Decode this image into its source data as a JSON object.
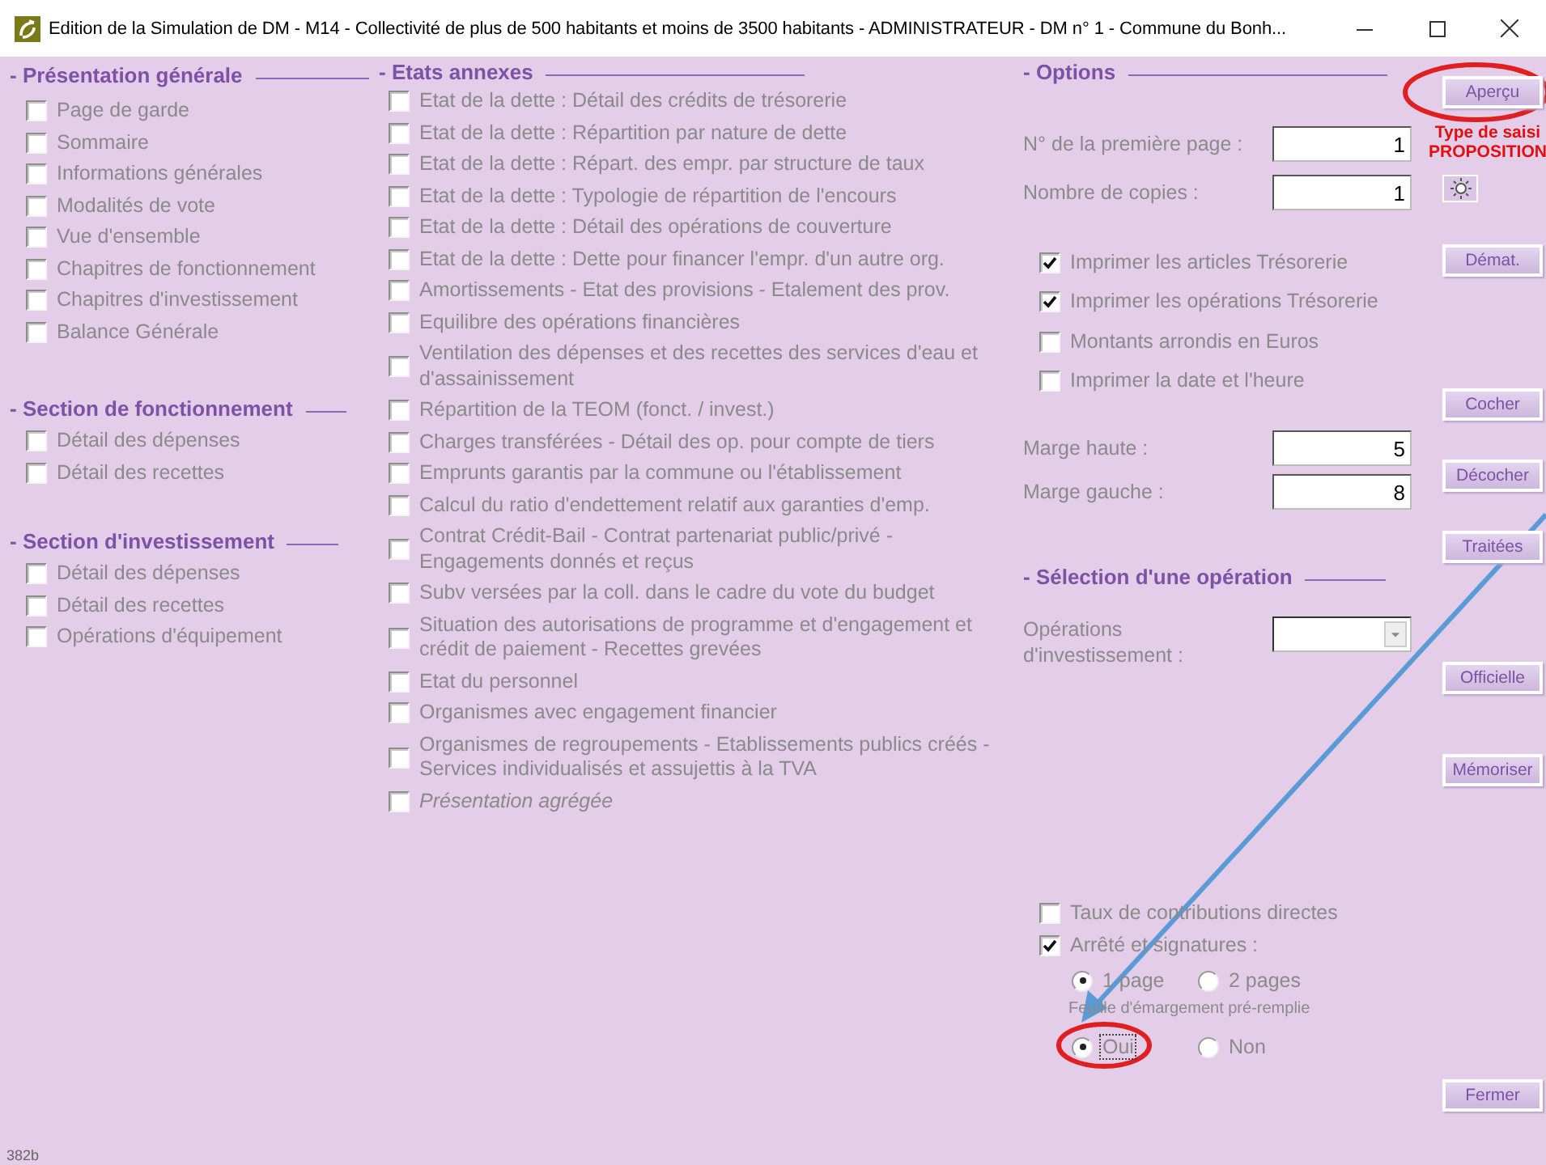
{
  "window": {
    "title": "Edition de la Simulation de DM - M14 - Collectivité de plus de 500 habitants et moins de 3500 habitants - ADMINISTRATEUR - DM n° 1 - Commune du Bonh..."
  },
  "left_sections": [
    {
      "title": "- Présentation générale",
      "items": [
        {
          "label": "Page de garde",
          "checked": false
        },
        {
          "label": "Sommaire",
          "checked": false
        },
        {
          "label": "Informations générales",
          "checked": false
        },
        {
          "label": "Modalités de vote",
          "checked": false
        },
        {
          "label": "Vue d'ensemble",
          "checked": false
        },
        {
          "label": "Chapitres de fonctionnement",
          "checked": false
        },
        {
          "label": "Chapitres d'investissement",
          "checked": false
        },
        {
          "label": "Balance Générale",
          "checked": false
        }
      ]
    },
    {
      "title": "- Section de fonctionnement",
      "items": [
        {
          "label": "Détail des dépenses",
          "checked": false
        },
        {
          "label": "Détail des recettes",
          "checked": false
        }
      ]
    },
    {
      "title": "- Section d'investissement",
      "items": [
        {
          "label": "Détail des dépenses",
          "checked": false
        },
        {
          "label": "Détail des recettes",
          "checked": false
        },
        {
          "label": "Opérations d'équipement",
          "checked": false
        }
      ]
    }
  ],
  "etats_annexes": {
    "title": "- Etats annexes",
    "items": [
      {
        "label": "Etat de la dette : Détail des crédits de trésorerie",
        "checked": false,
        "kind": "plain"
      },
      {
        "label": "Etat de la dette : Répartition par nature de dette",
        "checked": false,
        "kind": "plain"
      },
      {
        "label": "Etat de la dette : Répart. des empr. par structure de taux",
        "checked": false,
        "kind": "plain"
      },
      {
        "label": "Etat de la dette : Typologie de répartition de l'encours",
        "checked": false,
        "kind": "plain"
      },
      {
        "label": "Etat de la dette : Détail des opérations de couverture",
        "checked": false,
        "kind": "plain"
      },
      {
        "label": "Etat de la dette : Dette pour financer l'empr. d'un autre org.",
        "checked": false,
        "kind": "plain"
      },
      {
        "label": "Amortissements - Etat des provisions - Etalement des prov.",
        "checked": false,
        "kind": "plain"
      },
      {
        "label": "Equilibre des opérations financières",
        "checked": false,
        "kind": "plain"
      },
      {
        "label": "Ventilation des dépenses et des recettes des services d'eau et d'assainissement",
        "checked": false,
        "kind": "plain"
      },
      {
        "label": "Répartition de la TEOM (fonct. / invest.)",
        "checked": false,
        "kind": "plain"
      },
      {
        "label": "Charges transférées - Détail des op. pour compte de tiers",
        "checked": false,
        "kind": "plain"
      },
      {
        "label": "Emprunts garantis par la commune ou l'établissement",
        "checked": false,
        "kind": "plain"
      },
      {
        "label": "Calcul du ratio d'endettement relatif aux garanties d'emp.",
        "checked": false,
        "kind": "plain"
      },
      {
        "label": "Contrat Crédit-Bail - Contrat partenariat public/privé - Engagements donnés et reçus",
        "checked": false,
        "kind": "plain"
      },
      {
        "label": "Subv versées par la coll. dans le cadre du vote du budget",
        "checked": false,
        "kind": "plain"
      },
      {
        "label": "Situation des autorisations de programme et d'engagement et crédit de paiement - Recettes grevées",
        "checked": false,
        "kind": "plain"
      },
      {
        "label": "Etat du personnel",
        "checked": false,
        "kind": "plain"
      },
      {
        "label": "Organismes avec engagement financier",
        "checked": false,
        "kind": "plain"
      },
      {
        "label": "Organismes de regroupements - Etablissements publics créés - Services individualisés et assujettis à la TVA",
        "checked": false,
        "kind": "plain"
      },
      {
        "label": "Présentation agrégée",
        "checked": false,
        "kind": "italic"
      }
    ]
  },
  "options": {
    "title": "- Options",
    "page_fields": [
      {
        "label": "N° de la première page :",
        "value": "1"
      },
      {
        "label": "Nombre de copies :",
        "value": "1"
      }
    ],
    "print_checks": [
      {
        "label": "Imprimer les articles Trésorerie",
        "checked": true
      },
      {
        "label": "Imprimer les opérations Trésorerie",
        "checked": true
      },
      {
        "label": "Montants arrondis en Euros",
        "checked": false
      },
      {
        "label": "Imprimer la date et l'heure",
        "checked": false
      }
    ],
    "margin_fields": [
      {
        "label": "Marge haute :",
        "value": "5"
      },
      {
        "label": "Marge gauche :",
        "value": "8"
      }
    ]
  },
  "operation_selection": {
    "title": "- Sélection d'une opération",
    "label": "Opérations d'investissement :"
  },
  "extras": {
    "checks": [
      {
        "label": "Taux de contributions directes",
        "checked": false
      },
      {
        "label": "Arrêté et signatures :",
        "checked": true
      }
    ],
    "page_radios": [
      {
        "label": "1 page",
        "selected": true
      },
      {
        "label": "2 pages",
        "selected": false
      }
    ],
    "caption": "Feuille d'émargement pré-remplie",
    "fill_radios": [
      {
        "label": "Oui",
        "selected": true,
        "focused": true
      },
      {
        "label": "Non",
        "selected": false,
        "focused": false
      }
    ]
  },
  "entry_type": [
    "Type de saisi",
    "PROPOSITION"
  ],
  "buttons": [
    {
      "kind": "text",
      "label": "Aperçu"
    },
    {
      "kind": "icon"
    },
    {
      "kind": "text",
      "label": "Démat."
    },
    {
      "kind": "text",
      "label": "Cocher"
    },
    {
      "kind": "text",
      "label": "Décocher"
    },
    {
      "kind": "text",
      "label": "Traitées"
    },
    {
      "kind": "text",
      "label": "Officielle"
    },
    {
      "kind": "text",
      "label": "Mémoriser"
    },
    {
      "kind": "text",
      "label": "Fermer"
    }
  ],
  "footer": "382b",
  "annotations": [
    {
      "kind": "ellipse"
    },
    {
      "kind": "ellipse"
    },
    {
      "kind": "arrow"
    }
  ]
}
